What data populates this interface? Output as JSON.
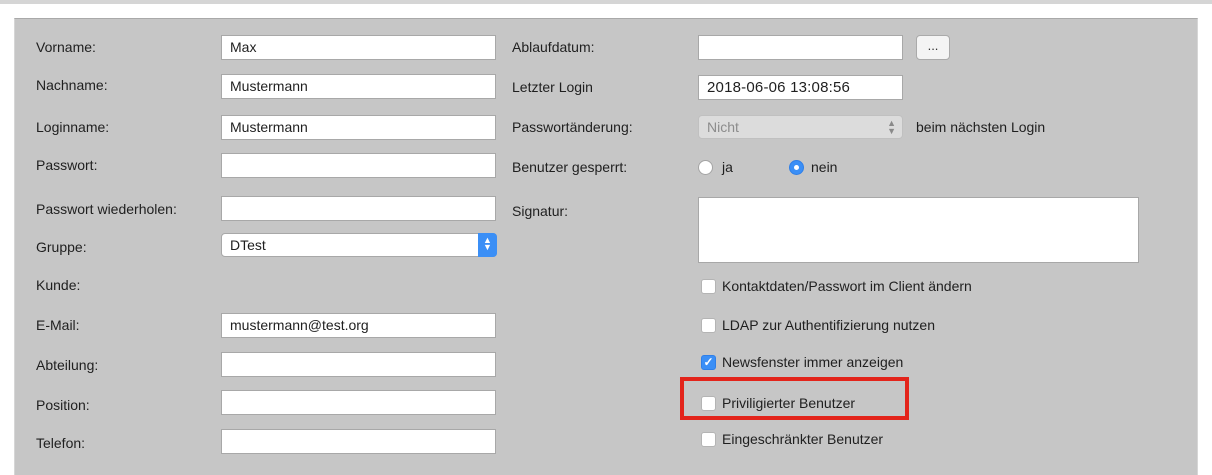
{
  "left": {
    "vorname": {
      "label": "Vorname:",
      "value": "Max"
    },
    "nachname": {
      "label": "Nachname:",
      "value": "Mustermann"
    },
    "loginname": {
      "label": "Loginname:",
      "value": "Mustermann"
    },
    "passwort": {
      "label": "Passwort:",
      "value": ""
    },
    "passwort_wdh": {
      "label": "Passwort wiederholen:",
      "value": ""
    },
    "gruppe": {
      "label": "Gruppe:",
      "value": "DTest"
    },
    "kunde": {
      "label": "Kunde:"
    },
    "email": {
      "label": "E-Mail:",
      "value": "mustermann@test.org"
    },
    "abteilung": {
      "label": "Abteilung:",
      "value": ""
    },
    "position": {
      "label": "Position:",
      "value": ""
    },
    "telefon": {
      "label": "Telefon:",
      "value": ""
    }
  },
  "right": {
    "ablaufdatum": {
      "label": "Ablaufdatum:",
      "value": "",
      "button": "..."
    },
    "letzter_login": {
      "label": "Letzter Login",
      "value": "2018-06-06 13:08:56"
    },
    "passwortaenderung": {
      "label": "Passwortänderung:",
      "value": "Nicht",
      "suffix": "beim nächsten Login"
    },
    "gesperrt": {
      "label": "Benutzer gesperrt:",
      "option_ja": "ja",
      "option_nein": "nein",
      "selected": "nein"
    },
    "signatur": {
      "label": "Signatur:"
    },
    "checkboxes": [
      {
        "label": "Kontaktdaten/Passwort im Client ändern",
        "checked": false
      },
      {
        "label": "LDAP zur Authentifizierung nutzen",
        "checked": false
      },
      {
        "label": "Newsfenster immer anzeigen",
        "checked": true
      },
      {
        "label": "Priviligierter Benutzer",
        "checked": false
      },
      {
        "label": "Eingeschränkter Benutzer",
        "checked": false
      }
    ]
  },
  "colors": {
    "panel": "#c6c6c6",
    "accent": "#3b8ff6",
    "highlight": "#e3241b"
  },
  "icons": {
    "check": "checkmark-icon",
    "select": "stepper-arrows-icon"
  }
}
